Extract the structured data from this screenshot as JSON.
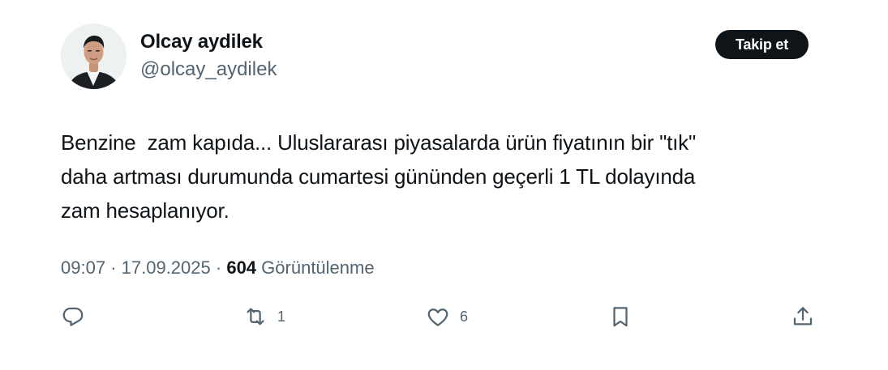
{
  "author": {
    "name": "Olcay aydilek",
    "handle": "@olcay_aydilek",
    "avatar_icon": "profile-photo"
  },
  "follow_label": "Takip et",
  "tweet": {
    "text": "Benzine  zam kapıda... Uluslararası piyasalarda ürün fiyatının bir \"tık\"\ndaha artması durumunda cumartesi gününden geçerli 1 TL dolayında\nzam hesaplanıyor.",
    "time": "09:07",
    "date": "17.09.2025",
    "separator": "·",
    "views_count": "604",
    "views_label": "Görüntülenme"
  },
  "actions": {
    "reply": {
      "icon": "reply-icon",
      "count": ""
    },
    "retweet": {
      "icon": "retweet-icon",
      "count": "1"
    },
    "like": {
      "icon": "heart-icon",
      "count": "6"
    },
    "bookmark": {
      "icon": "bookmark-icon",
      "count": ""
    },
    "share": {
      "icon": "share-icon",
      "count": ""
    }
  },
  "colors": {
    "text_primary": "#0f1419",
    "text_secondary": "#536471",
    "button_bg": "#0f1419",
    "button_text": "#ffffff"
  }
}
